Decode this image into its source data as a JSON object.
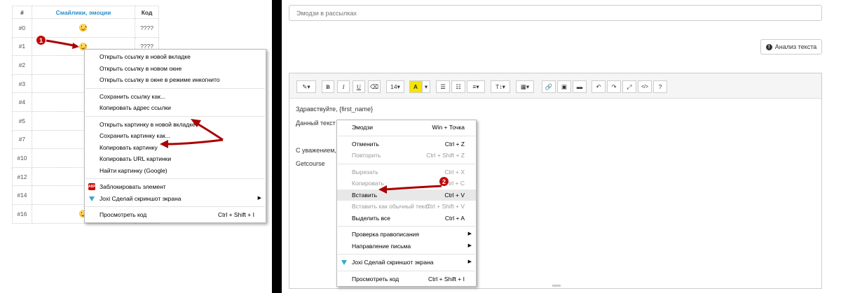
{
  "left_table": {
    "headers": [
      "#",
      "Смайлики, эмоции",
      "Код"
    ],
    "rows": [
      {
        "num": "#0",
        "code": "????"
      },
      {
        "num": "#1",
        "code": "????"
      },
      {
        "num": "#2",
        "code": ""
      },
      {
        "num": "#3",
        "code": ""
      },
      {
        "num": "#4",
        "code": ""
      },
      {
        "num": "#5",
        "code": ""
      },
      {
        "num": "#7",
        "code": ""
      },
      {
        "num": "#10",
        "code": ""
      },
      {
        "num": "#12",
        "code": ""
      },
      {
        "num": "#14",
        "code": ""
      },
      {
        "num": "#16",
        "code": "????"
      }
    ]
  },
  "browser_menu": {
    "items": [
      {
        "label": "Открыть ссылку в новой вкладке"
      },
      {
        "label": "Открыть ссылку в новом окне"
      },
      {
        "label": "Открыть ссылку в окне в режиме инкогнито"
      },
      {
        "label": "Сохранить ссылку как..."
      },
      {
        "label": "Копировать адрес ссылки"
      },
      {
        "label": "Открыть картинку в новой вкладке"
      },
      {
        "label": "Сохранить картинку как..."
      },
      {
        "label": "Копировать картинку"
      },
      {
        "label": "Копировать URL картинки"
      },
      {
        "label": "Найти картинку (Google)"
      },
      {
        "label": "Заблокировать элемент",
        "icon": "adblock-icon",
        "icon_text": "ABP"
      },
      {
        "label": "Joxi Сделай скриншот экрана",
        "icon": "joxi-icon"
      },
      {
        "label": "Просмотреть код",
        "shortcut": "Ctrl + Shift + I"
      }
    ]
  },
  "step_badges": [
    "1",
    "2"
  ],
  "subject": {
    "placeholder": "Эмодзи в рассылках"
  },
  "analyze_button": {
    "label": "Анализ текста",
    "icon": "info-circle-icon"
  },
  "toolbar": {
    "magic": "✎▾",
    "bold": "B",
    "italic": "I",
    "underline": "U",
    "eraser": "⌫",
    "font_size": "14▾",
    "color": "A",
    "color_caret": "▾",
    "ul": "☰",
    "ol": "☷",
    "align": "≡▾",
    "text_height": "T↕▾",
    "table": "▦▾",
    "link": "🔗",
    "image": "▣",
    "video": "▬",
    "undo": "↶",
    "redo": "↷",
    "fullscreen": "⤢",
    "code": "</>",
    "help": "?"
  },
  "editor": {
    "greeting": "Здравствуйте, {first_name}",
    "body_start": "Данный текст",
    "regards": "С уважением,",
    "signature": "Getcourse"
  },
  "editor_menu": {
    "items": [
      {
        "label": "Эмодзи",
        "shortcut": "Win + Точка"
      },
      {
        "label": "Отменить",
        "shortcut": "Ctrl + Z"
      },
      {
        "label": "Повторить",
        "shortcut": "Ctrl + Shift + Z",
        "disabled": true
      },
      {
        "label": "Вырезать",
        "shortcut": "Ctrl + X",
        "disabled": true
      },
      {
        "label": "Копировать",
        "shortcut": "Ctrl + C",
        "disabled": true
      },
      {
        "label": "Вставить",
        "shortcut": "Ctrl + V",
        "highlighted": true
      },
      {
        "label": "Вставить как обычный текст",
        "shortcut": "Ctrl + Shift + V",
        "disabled": true
      },
      {
        "label": "Выделить все",
        "shortcut": "Ctrl + A"
      },
      {
        "label": "Проверка правописания"
      },
      {
        "label": "Направление письма"
      },
      {
        "label": "Joxi Сделай скриншот экрана",
        "icon": "joxi-icon"
      },
      {
        "label": "Просмотреть код",
        "shortcut": "Ctrl + Shift + I"
      }
    ]
  },
  "colors": {
    "accent": "#2a8fc9",
    "highlight_yellow": "#f5e400",
    "annotation_red": "#c10a0a"
  }
}
